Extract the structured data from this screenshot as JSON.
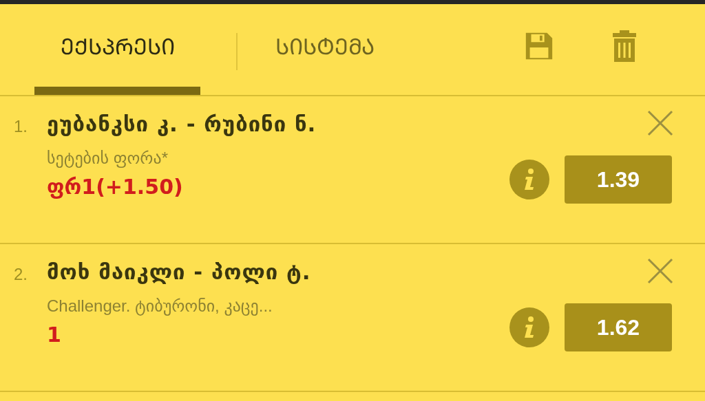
{
  "tabs": [
    {
      "label": "ᲔᲥᲡᲞᲠᲔᲡᲘ",
      "selected": true
    },
    {
      "label": "ᲡᲘᲡᲢᲔᲛᲐ",
      "selected": false
    }
  ],
  "bets": [
    {
      "number": "1.",
      "event": "ეუბანკსი კ. - რუბინი ნ.",
      "market": "სეტების ფორა*",
      "selection": "ფრ1(+1.50)",
      "odds": "1.39"
    },
    {
      "number": "2.",
      "event": "მოხ მაიკლი - პოლი ტ.",
      "market": "Challenger. ტიბურონი, კაცე...",
      "selection": "1",
      "odds": "1.62"
    }
  ]
}
